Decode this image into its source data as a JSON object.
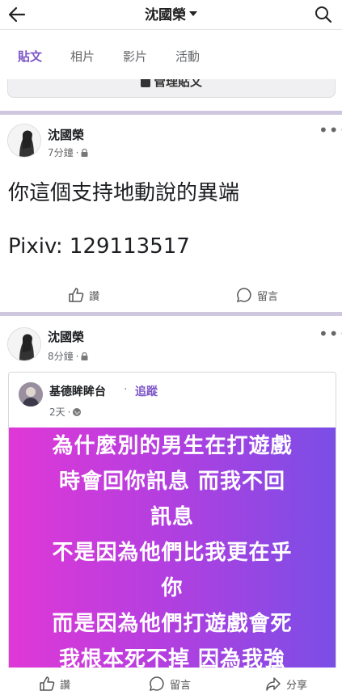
{
  "header": {
    "title": "沈國榮"
  },
  "tabs": [
    {
      "label": "貼文",
      "active": true
    },
    {
      "label": "相片",
      "active": false
    },
    {
      "label": "影片",
      "active": false
    },
    {
      "label": "活動",
      "active": false
    }
  ],
  "manage_posts": {
    "label": "管理貼文"
  },
  "post1": {
    "author": "沈國榮",
    "time": "7分鐘",
    "text_line1": "你這個支持地動說的異端",
    "text_line2": "Pixiv: 129113517",
    "like_label": "讚",
    "comment_label": "留言"
  },
  "post2": {
    "author": "沈國榮",
    "time": "8分鐘",
    "shared": {
      "page_name": "基德眸眸台",
      "follow_label": "追蹤",
      "time": "2天",
      "image_text": [
        "為什麼別的男生在打遊戲",
        "時會回你訊息 而我不回",
        "訊息",
        "不是因為他們比我更在乎",
        "你",
        "而是因為他們打遊戲會死",
        "我根本死不掉 因為我強"
      ]
    },
    "like_label": "讚",
    "comment_label": "留言",
    "share_label": "分享"
  },
  "colors": {
    "accent": "#7b54c8",
    "divider": "#cfc7de"
  }
}
